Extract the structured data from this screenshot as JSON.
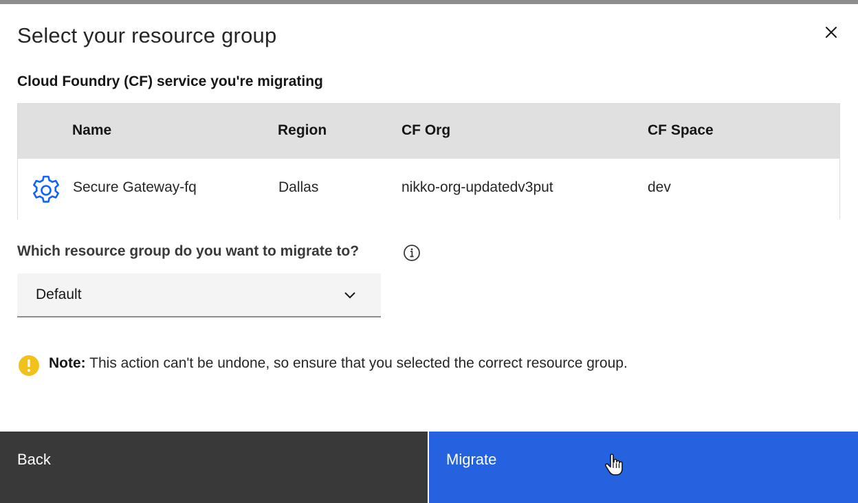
{
  "modal": {
    "title": "Select your resource group",
    "close_icon": "close-icon"
  },
  "service_section": {
    "label": "Cloud Foundry (CF) service you're migrating",
    "columns": [
      "Name",
      "Region",
      "CF Org",
      "CF Space"
    ],
    "rows": [
      {
        "icon": "gear-icon",
        "name": "Secure Gateway-fq",
        "region": "Dallas",
        "cf_org": "nikko-org-updatedv3put",
        "cf_space": "dev"
      }
    ]
  },
  "resource_group": {
    "question": "Which resource group do you want to migrate to?",
    "info_icon": "info-icon",
    "selected_value": "Default",
    "chevron_icon": "chevron-down-icon"
  },
  "notice": {
    "icon": "warning-icon",
    "label": "Note:",
    "text": "This action can't be undone, so ensure that you selected the correct resource group."
  },
  "footer": {
    "back_label": "Back",
    "migrate_label": "Migrate"
  },
  "colors": {
    "primary": "#2462e0",
    "secondary": "#393939",
    "warning": "#f1c21b",
    "icon_blue": "#0f62fe"
  }
}
